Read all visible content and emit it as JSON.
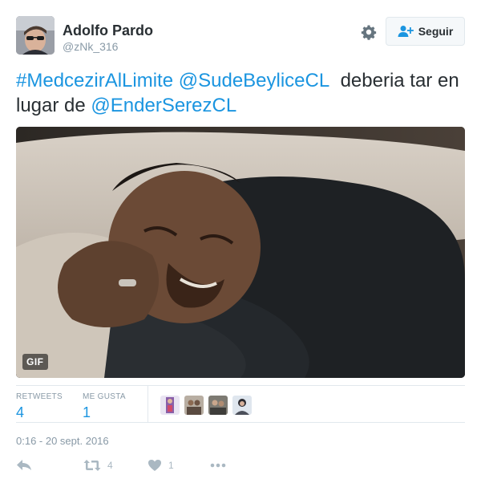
{
  "user": {
    "name": "Adolfo Pardo",
    "handle": "@zNk_316"
  },
  "follow_label": "Seguir",
  "tweet": {
    "hashtag": "#MedcezirAlLimite",
    "mention1": "@SudeBeyliceCL",
    "text_mid": "deberia tar en lugar de",
    "mention2": "@EnderSerezCL"
  },
  "media": {
    "badge": "GIF"
  },
  "stats": {
    "retweets_label": "RETWEETS",
    "retweets_count": "4",
    "likes_label": "ME GUSTA",
    "likes_count": "1"
  },
  "timestamp": "0:16 - 20 sept. 2016",
  "actions": {
    "reply_icon": "reply-icon",
    "retweet_count": "4",
    "like_count": "1",
    "more_icon": "more-icon"
  },
  "colors": {
    "link": "#1b95e0",
    "muted": "#8899a6",
    "border": "#e1e8ed"
  }
}
